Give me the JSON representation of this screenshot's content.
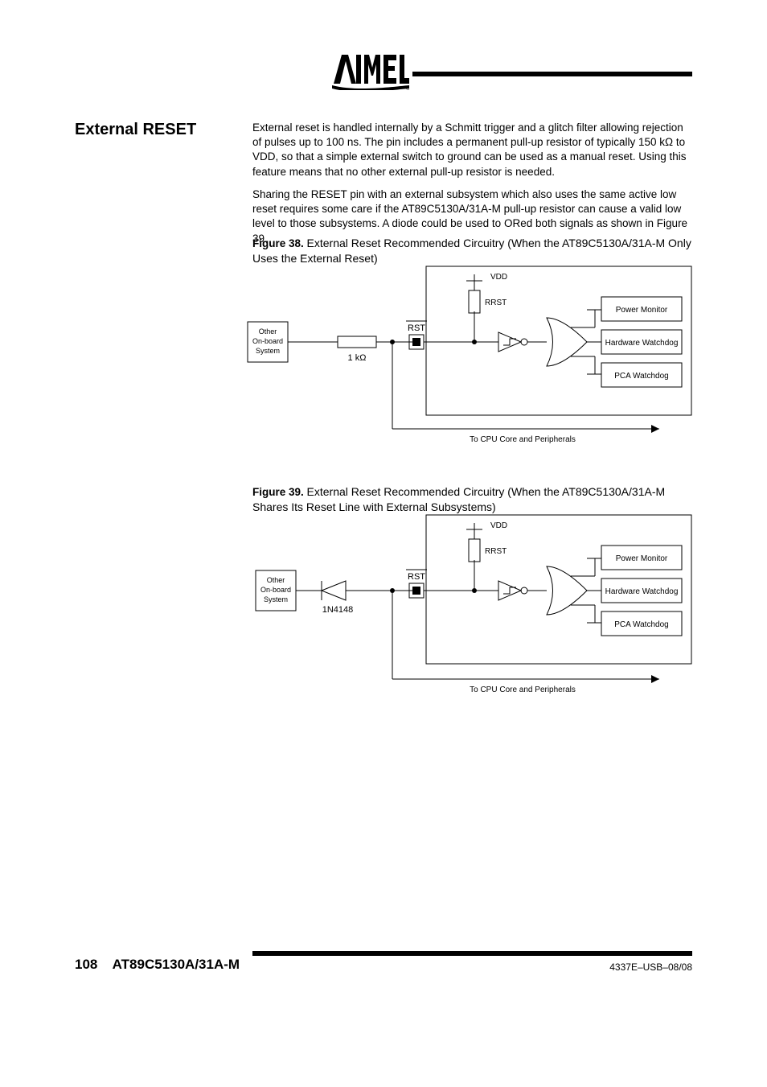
{
  "logo": {
    "text": "AIMEL",
    "reg": "®"
  },
  "leftcol": {
    "heading": "External RESET"
  },
  "para1": "External reset is handled internally by a Schmitt trigger and a glitch filter allowing rejection of pulses up to 100 ns. The pin includes a permanent pull-up resistor of typically 150 kΩ to VDD, so that a simple external switch to ground can be used as a manual reset. Using this feature means that no other external pull-up resistor is needed.",
  "para2": "Sharing the RESET pin with an external subsystem which also uses the same active low reset requires some care if the AT89C5130A/31A-M pull-up resistor can cause a valid low level to those subsystems. A diode could be used to ORed both signals as shown in Figure 39.",
  "fig1": {
    "caption_b": "Figure 38.",
    "caption": "External Reset Recommended Circuitry (When the AT89C5130A/31A-M Only Uses the External Reset)",
    "other": "Other On-board System",
    "r": "1 kΩ",
    "pin": "RST",
    "vdd": "VDD",
    "rpu": "RRST",
    "noise": "To CPU Core and Peripherals",
    "s1": "Power Monitor",
    "s2": "Hardware Watchdog",
    "s3": "PCA Watchdog"
  },
  "fig2": {
    "caption_b": "Figure 39.",
    "caption": "External Reset Recommended Circuitry (When the AT89C5130A/31A-M Shares Its Reset Line with External Subsystems)",
    "other": "Other On-board System",
    "d": "1N4148",
    "pin": "RST",
    "vdd": "VDD",
    "rpu": "RRST",
    "noise": "To CPU Core and Peripherals",
    "s1": "Power Monitor",
    "s2": "Hardware Watchdog",
    "s3": "PCA Watchdog"
  },
  "footer": {
    "page": "108",
    "doc": "AT89C5130A/31A-M",
    "rev": "4337E–USB–08/08"
  }
}
